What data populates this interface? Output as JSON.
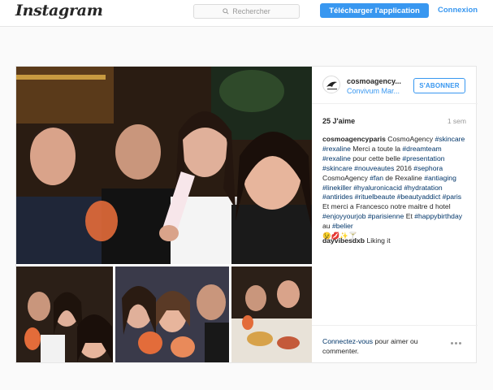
{
  "header": {
    "logo": "Instagram",
    "search_placeholder": "Rechercher",
    "download_label": "Télécharger l'application",
    "login_label": "Connexion"
  },
  "post": {
    "username": "cosmoagency...",
    "location": "Convivum Mar...",
    "follow_label": "S'ABONNER",
    "likes": "25 J'aime",
    "time": "1 sem",
    "caption": {
      "author": "cosmoagencyparis",
      "text_1": " CosmoAgency ",
      "tag_skincare": "#skincare",
      "sp_1": " ",
      "tag_rexaline": "#rexaline",
      "text_2": " Merci a toute la ",
      "tag_dreamteam": "#dreamteam",
      "sp_2": " ",
      "tag_rexaline_2": "#rexaline",
      "text_3": " pour cette belle ",
      "tag_presentation": "#presentation",
      "sp_3": " ",
      "tag_skincare_2": "#skincare",
      "sp_4": " ",
      "tag_nouveautes": "#nouveautes",
      "text_4": " 2016 ",
      "tag_sephora": "#sephora",
      "text_5": " CosmoAgency ",
      "tag_fan": "#fan",
      "text_6": " de Rexaline ",
      "tag_antiaging": "#antiaging",
      "sp_5": " ",
      "tag_linekiller": "#linekiller",
      "sp_6": " ",
      "tag_hyaluronicacid": "#hyaluronicacid",
      "sp_7": " ",
      "tag_hydratation": "#hydratation",
      "sp_8": " ",
      "tag_antirides": "#antirides",
      "sp_9": " ",
      "tag_rituelbeaute": "#rituelbeaute",
      "sp_10": " ",
      "tag_beautyaddict": "#beautyaddict",
      "sp_11": " ",
      "tag_paris": "#paris",
      "text_7": " Et merci a Francesco notre maitre d hotel ",
      "tag_enjoyyourjob": "#enjoyyourjob",
      "sp_12": " ",
      "tag_parisienne": "#parisienne",
      "text_8": " Et ",
      "tag_happybirthday": "#happybirthday",
      "text_9": " au ",
      "tag_belier": "#belier",
      "emoji": "😉💋✨🍸"
    },
    "comment": {
      "author": "dayvibesdxb",
      "text": " Liking it"
    },
    "login_prompt": {
      "link": "Connectez-vous",
      "text": " pour aimer ou commenter."
    }
  },
  "colors": {
    "accent": "#3897f0",
    "hashtag": "#003569",
    "muted": "#999999",
    "text": "#262626"
  },
  "icons": [
    "search-icon",
    "more-options-icon",
    "profile-avatar"
  ]
}
